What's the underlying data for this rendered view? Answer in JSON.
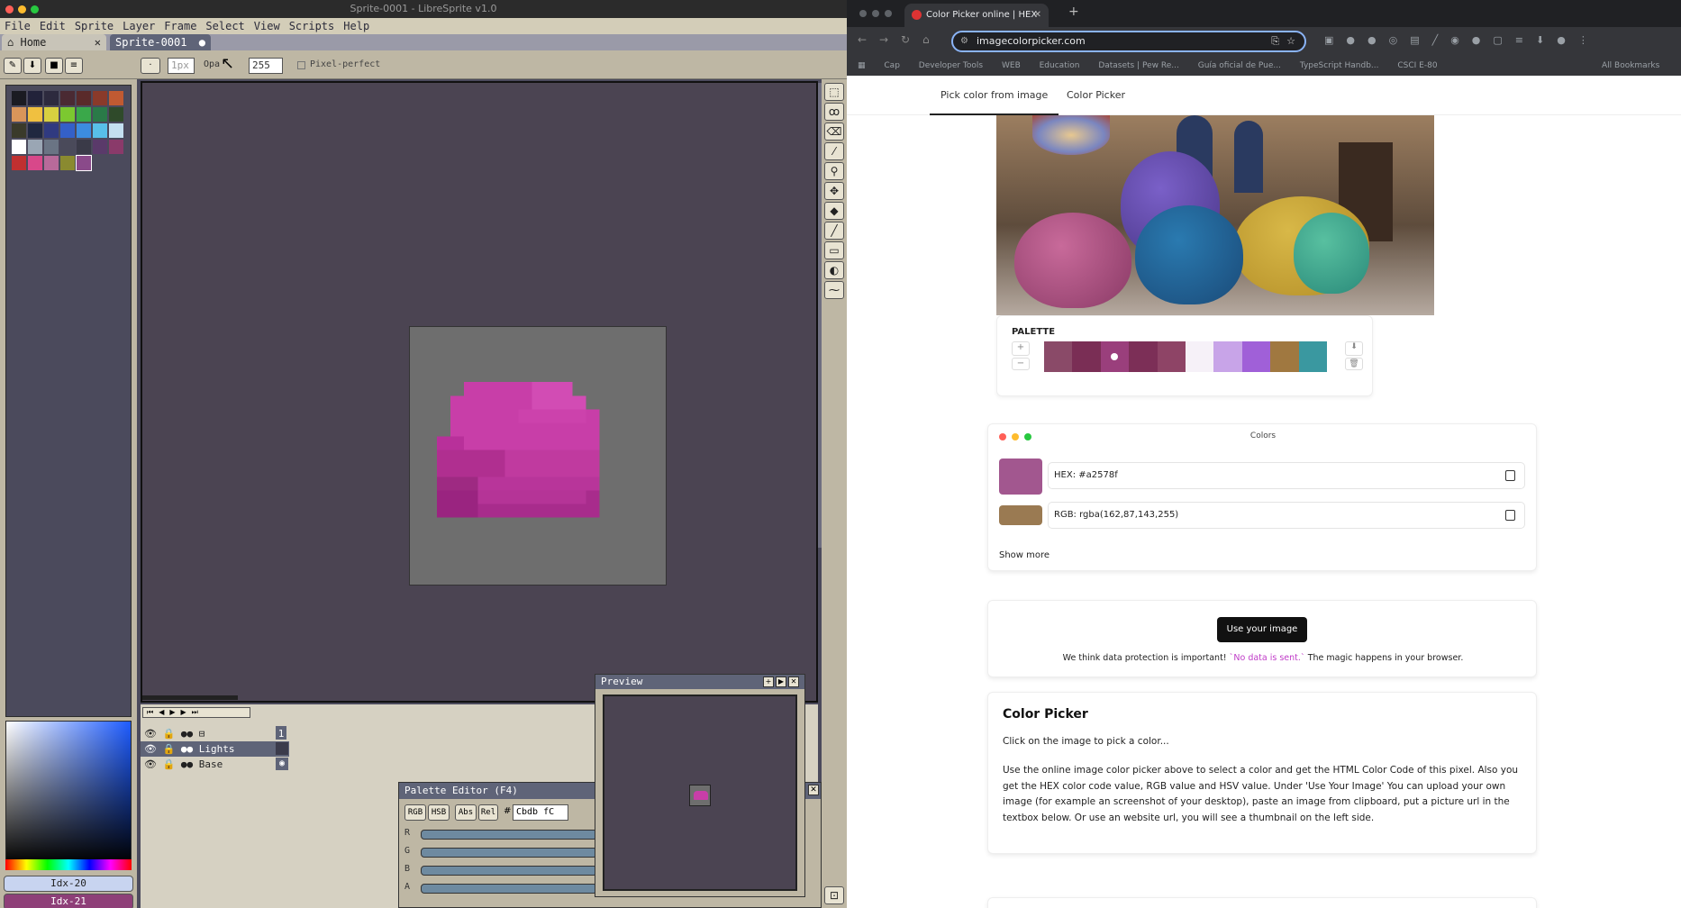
{
  "libresprite": {
    "title": "Sprite-0001 - LibreSprite v1.0",
    "menu": [
      "File",
      "Edit",
      "Sprite",
      "Layer",
      "Frame",
      "Select",
      "View",
      "Scripts",
      "Help"
    ],
    "tabs": [
      {
        "label": "Home"
      },
      {
        "label": "Sprite-0001"
      }
    ],
    "toolbar": {
      "size_value": "1px",
      "opacity_label": "Opa",
      "opacity_value": "255",
      "pixel_perfect_label": "Pixel-perfect"
    },
    "palette_colors": [
      "#1b1b22",
      "#22223a",
      "#2d2a3e",
      "#4a2a33",
      "#5a2a2a",
      "#8a3a2a",
      "#c05a32",
      "#d9955a",
      "#f0c040",
      "#d8d040",
      "#7cc830",
      "#3aa84a",
      "#2a7a48",
      "#2f4a2a",
      "#3a3a2a",
      "#202840",
      "#303a80",
      "#3460c8",
      "#3c8ce0",
      "#58c0e8",
      "#c4e0f0",
      "#ffffff",
      "#9aa6b4",
      "#6a7484",
      "#4a4a5a",
      "#3a3a48",
      "#5a3a6a",
      "#8a3a6a",
      "#c03030",
      "#d8488a",
      "#b86a9a",
      "#8a8a30",
      "#8a4a8a"
    ],
    "selected_swatch_index": 32,
    "idx_buttons": [
      "Idx-20",
      "Idx-21"
    ],
    "layers": [
      {
        "name": "Lights"
      },
      {
        "name": "Base"
      }
    ],
    "frame_number": "1",
    "preview_title": "Preview",
    "palette_editor": {
      "title": "Palette Editor (F4)",
      "modes": [
        "RGB",
        "HSB",
        "Abs",
        "Rel"
      ],
      "hex_prefix": "#",
      "hex_value": "Cbdb fC",
      "channels": [
        "R",
        "G",
        "B",
        "A"
      ]
    }
  },
  "browser": {
    "tab_title": "Color Picker online | HEX",
    "url": "imagecolorpicker.com",
    "bookmarks": [
      "Cap",
      "Developer Tools",
      "WEB",
      "Education",
      "Datasets | Pew Re...",
      "Guía oficial de Pue...",
      "TypeScript Handb...",
      "CSCI E-80",
      "All Bookmarks"
    ],
    "nav": {
      "pick_tab": "Pick color from image",
      "picker_tab": "Color Picker"
    },
    "palette_label": "PALETTE",
    "palette_swatches": [
      "#8a4a68",
      "#7a2e55",
      "#9a3f7c",
      "#7c2f57",
      "#8e4466",
      "#f6f1f8",
      "#c8a4e8",
      "#a060d8",
      "#a07840",
      "#3a98a0"
    ],
    "colors_card": {
      "title": "Colors",
      "hex_label": "HEX:",
      "hex_value": "#a2578f",
      "hex_swatch": "#a2578f",
      "rgb_label": "RGB:",
      "rgb_value": "rgba(162,87,143,255)",
      "rgb_swatch": "#9a7a52",
      "show_more": "Show more"
    },
    "upload": {
      "button": "Use your image",
      "note_prefix": "We think data protection is important!",
      "note_highlight": "`No data is sent.`",
      "note_suffix": "The magic happens in your browser."
    },
    "info": {
      "heading": "Color Picker",
      "subtitle": "Click on the image to pick a color...",
      "body": "Use the online image color picker above to select a color and get the HTML Color Code of this pixel. Also you get the HEX color code value, RGB value and HSV value. Under 'Use Your Image' You can upload your own image (for example an screenshot of your desktop), paste an image from clipboard, put a picture url in the textbox below. Or use an website url, you will see a thumbnail on the left side."
    }
  }
}
